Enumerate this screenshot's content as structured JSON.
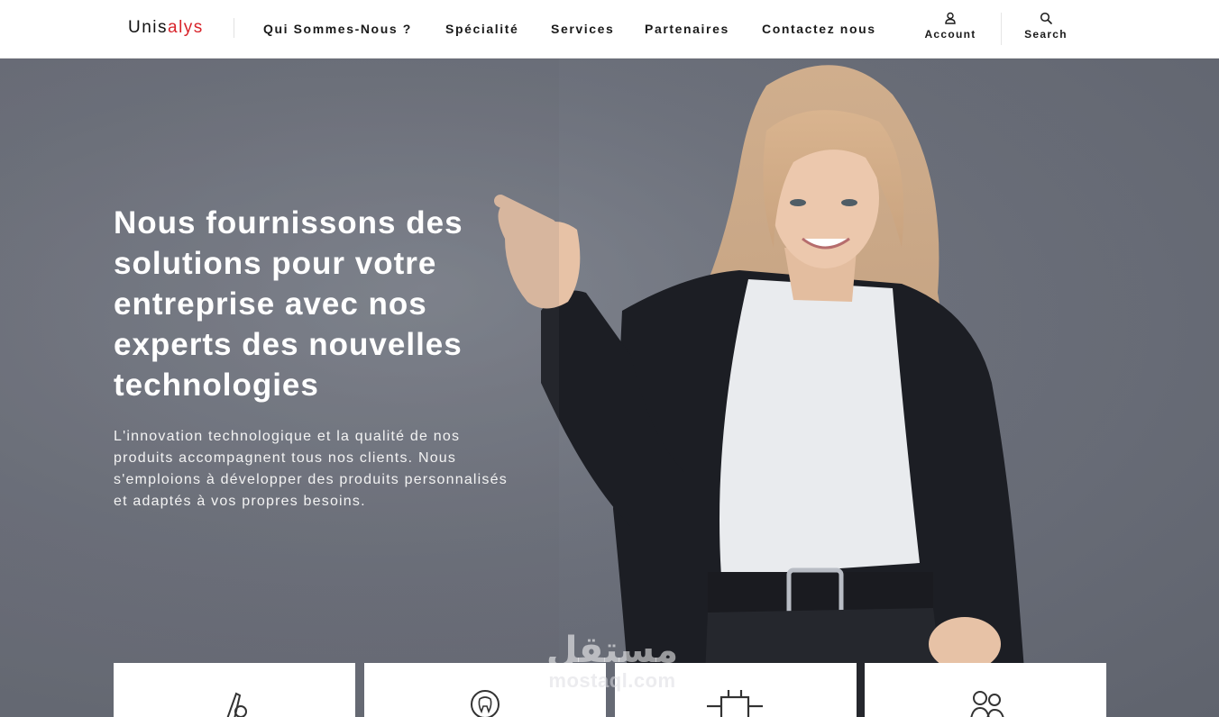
{
  "brand": {
    "name_part1": "Unis",
    "name_part2": "alys",
    "accent_color": "#d8232a"
  },
  "nav": {
    "items": [
      {
        "label": "Qui Sommes-Nous ?"
      },
      {
        "label": "Spécialité"
      },
      {
        "label": "Services"
      },
      {
        "label": "Partenaires"
      },
      {
        "label": "Contactez nous"
      }
    ]
  },
  "tools": {
    "account": {
      "label": "Account",
      "icon": "user-icon"
    },
    "search": {
      "label": "Search",
      "icon": "search-icon"
    }
  },
  "hero": {
    "title": "Nous fournissons des solutions pour votre entreprise avec nos experts des nouvelles technologies",
    "paragraph": "L'innovation technologique et la qualité de nos produits accompagnent tous nos clients. Nous s'emploions à développer des produits personnalisés et adaptés à vos propres besoins."
  },
  "cards": [
    {
      "icon": "tool-icon"
    },
    {
      "icon": "tooth-icon"
    },
    {
      "icon": "chip-icon"
    },
    {
      "icon": "people-icon"
    }
  ],
  "watermark": {
    "arabic": "مستقل",
    "latin": "mostaql.com"
  }
}
